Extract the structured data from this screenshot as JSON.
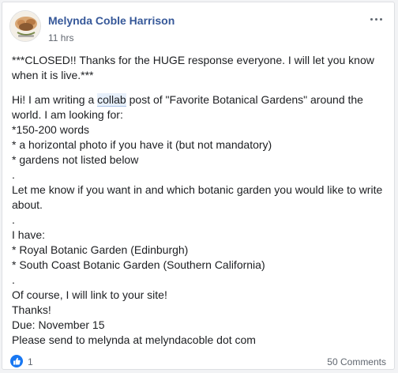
{
  "post": {
    "author": "Melynda Coble Harrison",
    "timestamp": "11 hrs",
    "text": {
      "line1a": "***CLOSED!! Thanks for the HUGE response everyone. I will let you know",
      "line1b": "when it is live.***",
      "p2a_pre": "Hi! I am writing a ",
      "p2a_link": "collab",
      "p2a_post": " post of \"Favorite Botanical Gardens\" around the",
      "p2b": "world. I am looking for:",
      "p2c": "*150-200 words",
      "p2d": "* a horizontal photo if you have it (but not mandatory)",
      "p2e": "* gardens not listed below",
      "dot1": ".",
      "p3a": "Let me know if you want in and which botanic garden you would like to write",
      "p3b": "about.",
      "dot2": ".",
      "p4a": "I have:",
      "p4b": "* Royal Botanic Garden (Edinburgh)",
      "p4c": "* South Coast Botanic Garden (Southern California)",
      "dot3": ".",
      "p5a": "Of course, I will link to your site!",
      "p5b": "Thanks!",
      "p5c": "Due: November 15",
      "p5d": "Please send to melynda at melyndacoble dot com"
    }
  },
  "footer": {
    "reaction_count": "1",
    "comments": "50 Comments"
  },
  "icons": {
    "like": "like-reaction-icon",
    "more": "more-options-icon"
  },
  "colors": {
    "author_link": "#365899",
    "like_blue": "#1877f2"
  }
}
